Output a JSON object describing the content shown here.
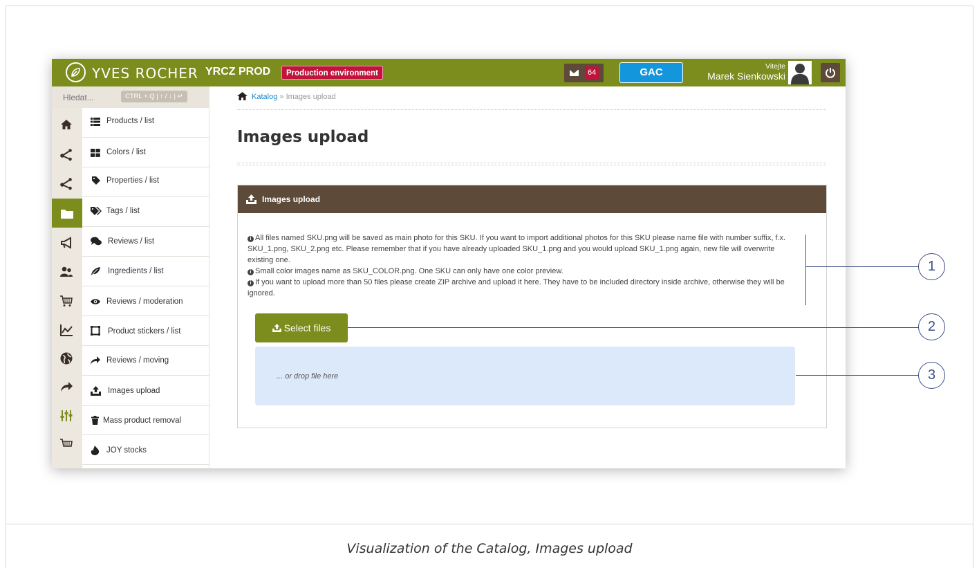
{
  "app": {
    "brand": "YVES ROCHER",
    "environment_name": "YRCZ PROD",
    "environment_badge": "Production environment",
    "message_count": "64",
    "gac_label": "GAC",
    "welcome_label": "Vitejte",
    "user_name": "Marek Sienkowski"
  },
  "search": {
    "placeholder": "Hledat...",
    "shortcut_hint": "CTRL + Q | ↑ / ↓ | ↵"
  },
  "rail_icons": [
    "home-icon",
    "share-icon",
    "share-icon",
    "folder-icon",
    "bullhorn-icon",
    "users-icon",
    "cart-icon",
    "chart-icon",
    "globe-icon",
    "forward-icon",
    "sliders-icon",
    "cart-icon"
  ],
  "menu": {
    "items": [
      {
        "label": "Products / list",
        "icon": "list-icon"
      },
      {
        "label": "Colors / list",
        "icon": "grid-icon"
      },
      {
        "label": "Properties / list",
        "icon": "tag-icon"
      },
      {
        "label": "Tags / list",
        "icon": "tags-icon"
      },
      {
        "label": "Reviews / list",
        "icon": "comments-icon"
      },
      {
        "label": "Ingredients / list",
        "icon": "leaf-icon"
      },
      {
        "label": "Reviews / moderation",
        "icon": "eye-icon"
      },
      {
        "label": "Product stickers / list",
        "icon": "square-icon"
      },
      {
        "label": "Reviews / moving",
        "icon": "share-arrow-icon"
      },
      {
        "label": "Images upload",
        "icon": "upload-icon"
      },
      {
        "label": "Mass product removal",
        "icon": "trash-icon"
      },
      {
        "label": "JOY stocks",
        "icon": "fire-icon"
      }
    ]
  },
  "breadcrumb": {
    "root": "Katalog",
    "separator": "»",
    "current": "Images upload"
  },
  "page": {
    "title": "Images upload"
  },
  "panel": {
    "title": "Images upload",
    "info_lines": [
      "All files named SKU.png will be saved as main photo for this SKU. If you want to import additional photos for this SKU please name file with number suffix, f.x. SKU_1.png, SKU_2.png etc. Please remember that if you have already uploaded SKU_1.png and you would upload SKU_1.png again, new file will overwrite existing one.",
      "Small color images name as SKU_COLOR.png. One SKU can only have one color preview.",
      "If you want to upload more than 50 files please create ZIP archive and upload it here. They have to be included directory inside archive, otherwise they will be ignored."
    ],
    "select_button": "Select files",
    "drop_text": "... or drop file here"
  },
  "annotations": [
    "1",
    "2",
    "3"
  ],
  "caption": "Visualization of the Catalog, Images upload",
  "colors": {
    "topbar": "#7c8c1d",
    "panel_header": "#5d4a38",
    "badge_red": "#c0143c",
    "gac_blue": "#1496dc",
    "dropzone": "#dce9fb",
    "annotation": "#3e4f87"
  }
}
